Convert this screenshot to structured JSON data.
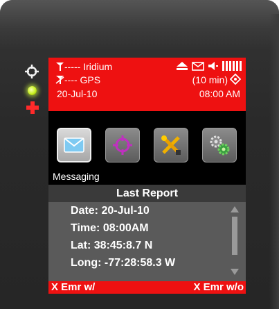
{
  "status_bar": {
    "satellite_label": "----- Iridium",
    "gps_label": "---- GPS",
    "interval": "(10 min)",
    "date": "20-Jul-10",
    "time": "08:00 AM",
    "signal_bars": 5,
    "accent": "#ee1111"
  },
  "apps": [
    {
      "name": "messaging",
      "icon": "envelope-icon",
      "selected": true
    },
    {
      "name": "position",
      "icon": "crosshair-icon",
      "selected": false
    },
    {
      "name": "tools",
      "icon": "tools-icon",
      "selected": false
    },
    {
      "name": "settings",
      "icon": "gears-icon",
      "selected": false
    }
  ],
  "selected_app_label": "Messaging",
  "report": {
    "title": "Last Report",
    "date": "Date: 20-Jul-10",
    "time": "Time: 08:00AM",
    "lat": "Lat: 38:45:8.7 N",
    "long": "Long: -77:28:58.3 W"
  },
  "softkeys": {
    "left": "X Emr w/",
    "right": "X Emr w/o"
  }
}
